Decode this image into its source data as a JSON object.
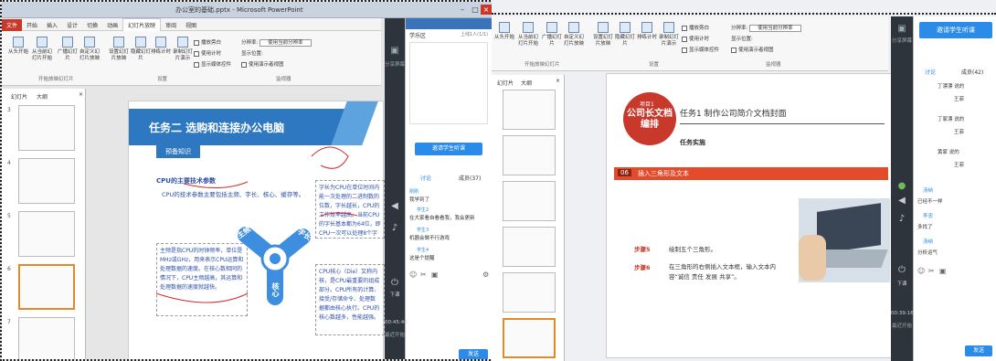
{
  "left": {
    "title": "办公室的基础.pptx - Microsoft PowerPoint",
    "menu": [
      "文件",
      "开始",
      "插入",
      "设计",
      "切换",
      "动画",
      "幻灯片放映",
      "审阅",
      "视图"
    ],
    "ribbon_buttons": [
      "从头开始",
      "从当前幻灯片开始",
      "广播幻灯片",
      "自定义幻灯片放映",
      "设置幻灯片放映",
      "隐藏幻灯片",
      "排练计时",
      "录制幻灯片演示"
    ],
    "checks": [
      "播放旁白",
      "使用计时",
      "显示媒体控件"
    ],
    "group_labels": [
      "开始放映幻灯片",
      "设置",
      "监视器"
    ],
    "monitor": {
      "label": "分辨率:",
      "value": "使用当前分辨率",
      "show_on": "显示位置:",
      "presenter": "使用演示者视图"
    },
    "tabs": [
      "幻灯片",
      "大纲"
    ],
    "thumb_numbers": [
      "3",
      "4",
      "5",
      "6",
      "7",
      "8"
    ],
    "slide": {
      "title": "任务二  选购和连接办公电脑",
      "badge": "预备知识",
      "heading": "CPU的主要技术参数",
      "line1": "CPU的技术参数主要包括主频、字长、核心、缓存等。",
      "left_box": "主频是指CPU的时钟频率，单位是MHz或GHz，用来表示CPU运算和处理数据的速度。在核心数相同的情况下，CPU主频越高，其运算和处理数据的速度就越快。",
      "right_box1": "字长为CPU在单位时间内能一次处理的二进制数的位数，字长越长，CPU的工作效率越高。当前CPU的字长基本都为64位，即CPU一次可以处理8个字节的数据。",
      "right_box2": "CPU核心（Die）又称内核，是CPU最重要的组成部分。CPU所有的计算、接受/存储命令、处理数据都由核心执行。CPU的核心数越多，性能越强。",
      "diagram": [
        "主频",
        "字长",
        "核心"
      ]
    },
    "chat": {
      "header": "学乐区",
      "online": "上线1人(1/1)",
      "live_button": "邀请学生听课",
      "tabs": [
        "讨论",
        "成员(37)"
      ],
      "messages": [
        {
          "name": "刚刚",
          "text": "我学到了"
        },
        {
          "name": "学生2",
          "text": "在大家看自看看我，我会更新"
        },
        {
          "name": "学生3",
          "text": "机器会做不行游戏"
        },
        {
          "name": "学生4",
          "text": "这是个提醒"
        }
      ],
      "send": "发送"
    },
    "rail": {
      "top": "分享屏幕",
      "mid": "下课",
      "time": "00:45:46",
      "status": "最近开始"
    }
  },
  "right": {
    "ribbon_buttons": [
      "从头开始",
      "从当前幻灯片开始",
      "广播幻灯片",
      "自定义幻灯片放映",
      "设置幻灯片放映",
      "隐藏幻灯片",
      "排练计时",
      "录制幻灯片演示"
    ],
    "checks": [
      "播放旁白",
      "使用计时",
      "显示媒体控件"
    ],
    "group_labels": [
      "开始放映幻灯片",
      "设置",
      "监视器"
    ],
    "monitor": {
      "label": "分辨率:",
      "value": "使用当前分辨率",
      "show_on": "显示位置:",
      "presenter": "使用演示者视图"
    },
    "tabs": [
      "幻灯片",
      "大纲"
    ],
    "slide": {
      "project": "项目1",
      "project_title": "公司长文档编排",
      "task": "任务1  制作公司简介文档封面",
      "section": "任务实施",
      "step_no": "06",
      "step_title": "插入三角形及文本",
      "step5_label": "步骤5",
      "step5_text": "绘制五个三角形。",
      "step6_label": "步骤6",
      "step6_text": "在三角形的右侧插入文本框，输入文本内容“诚信 责任 发展 共享”。"
    },
    "chat": {
      "header": "邀请学生听课",
      "tabs": [
        "讨论",
        "成员(42)"
      ],
      "messages": [
        "丁漂漂 说的",
        "王菲",
        "丁家漂 说的",
        "王菲",
        "黄家 说的",
        "王菲",
        "汤纳",
        "已经不一样",
        "李忠",
        "多找了",
        "汤纳",
        "分析运气"
      ],
      "send": "发送"
    },
    "rail": {
      "top": "分享屏幕",
      "mid": "下课",
      "time": "00:39:16",
      "status": "最近开始"
    }
  }
}
